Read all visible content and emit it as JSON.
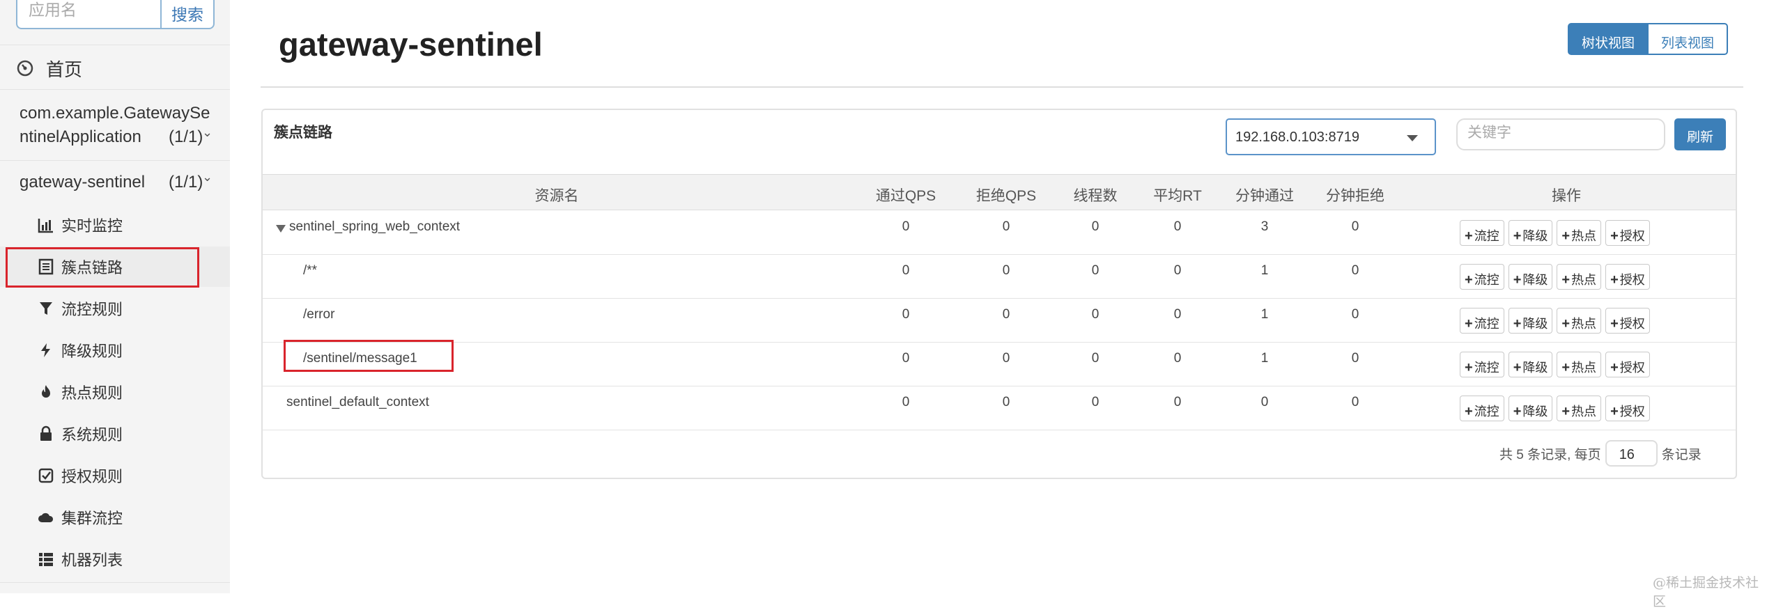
{
  "sidebar": {
    "search_placeholder": "应用名",
    "search_button": "搜索",
    "home": "首页",
    "apps": [
      {
        "name_line1": "com.example.GatewaySe",
        "name_line2": "ntinelApplication",
        "count": "(1/1)"
      },
      {
        "name_line1": "gateway-sentinel",
        "count": "(1/1)"
      }
    ],
    "menu": [
      {
        "label": "实时监控",
        "icon": "bar-chart-icon"
      },
      {
        "label": "簇点链路",
        "icon": "list-icon",
        "active": true
      },
      {
        "label": "流控规则",
        "icon": "filter-icon"
      },
      {
        "label": "降级规则",
        "icon": "flash-icon"
      },
      {
        "label": "热点规则",
        "icon": "fire-icon"
      },
      {
        "label": "系统规则",
        "icon": "lock-icon"
      },
      {
        "label": "授权规则",
        "icon": "check-square-icon"
      },
      {
        "label": "集群流控",
        "icon": "cloud-icon"
      },
      {
        "label": "机器列表",
        "icon": "th-list-icon"
      }
    ]
  },
  "main": {
    "title": "gateway-sentinel",
    "view_buttons": [
      "树状视图",
      "列表视图"
    ],
    "panel_title": "簇点链路",
    "machine": "192.168.0.103:8719",
    "keyword_placeholder": "关键字",
    "refresh": "刷新",
    "columns": [
      "资源名",
      "通过QPS",
      "拒绝QPS",
      "线程数",
      "平均RT",
      "分钟通过",
      "分钟拒绝",
      "操作"
    ],
    "rows": [
      {
        "name": "sentinel_spring_web_context",
        "expanded": true,
        "values": [
          "0",
          "0",
          "0",
          "0",
          "3",
          "0"
        ]
      },
      {
        "name": "/**",
        "values": [
          "0",
          "0",
          "0",
          "0",
          "1",
          "0"
        ]
      },
      {
        "name": "/error",
        "values": [
          "0",
          "0",
          "0",
          "0",
          "1",
          "0"
        ]
      },
      {
        "name": "/sentinel/message1",
        "highlighted": true,
        "values": [
          "0",
          "0",
          "0",
          "0",
          "1",
          "0"
        ]
      },
      {
        "name": "sentinel_default_context",
        "values": [
          "0",
          "0",
          "0",
          "0",
          "0",
          "0"
        ]
      }
    ],
    "actions": [
      "流控",
      "降级",
      "热点",
      "授权"
    ],
    "pager": {
      "prefix": "共 5 条记录, 每页",
      "page_size": "16",
      "suffix": "条记录"
    }
  },
  "watermark": "@稀土掘金技术社区",
  "colors": {
    "primary": "#3c7fb8",
    "highlight_border": "#d9242c",
    "sidebar_bg": "#f4f4f4"
  }
}
